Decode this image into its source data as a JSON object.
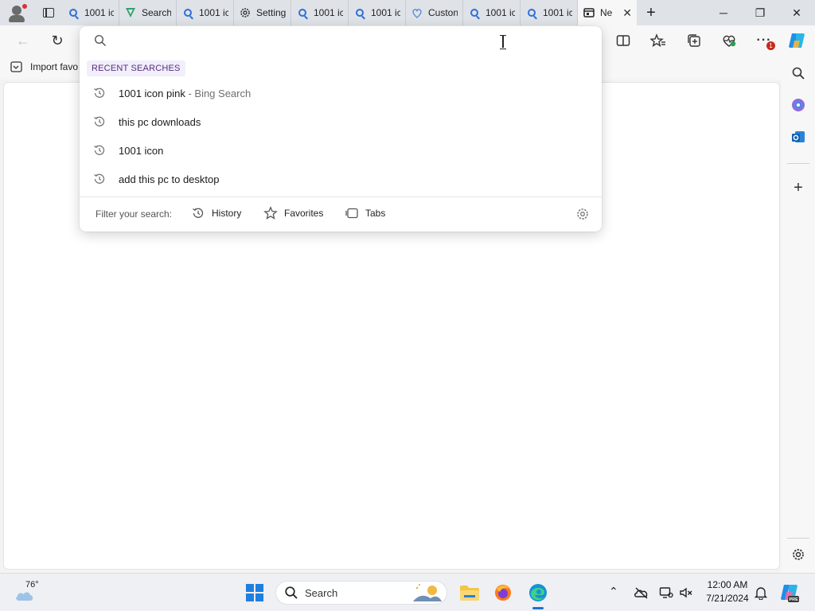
{
  "tabs": [
    {
      "icon": "search-icon",
      "title": "1001 ic"
    },
    {
      "icon": "search-tab-icon",
      "title": "Search"
    },
    {
      "icon": "search-icon",
      "title": "1001 ic"
    },
    {
      "icon": "settings-gear-icon",
      "title": "Setting"
    },
    {
      "icon": "search-icon",
      "title": "1001 ic"
    },
    {
      "icon": "search-icon",
      "title": "1001 ic"
    },
    {
      "icon": "shield-heart-icon",
      "title": "Custon"
    },
    {
      "icon": "search-icon",
      "title": "1001 ic"
    },
    {
      "icon": "search-icon",
      "title": "1001 ic"
    },
    {
      "icon": "new-tab-page-icon",
      "title": "Ne",
      "active": true
    }
  ],
  "favorites_bar": {
    "import_label": "Import favo"
  },
  "dropdown": {
    "search_placeholder": "",
    "heading": "RECENT SEARCHES",
    "items": [
      {
        "text": "1001 icon pink",
        "suffix": " - Bing Search"
      },
      {
        "text": "this pc downloads",
        "suffix": ""
      },
      {
        "text": "1001 icon",
        "suffix": ""
      },
      {
        "text": "add this pc to desktop",
        "suffix": ""
      }
    ],
    "filter_label": "Filter your search:",
    "filters": {
      "history": "History",
      "favorites": "Favorites",
      "tabs": "Tabs"
    }
  },
  "toolbar": {
    "notification_count": "1"
  },
  "taskbar": {
    "weather_temp": "76°",
    "search_label": "Search",
    "time": "12:00 AM",
    "date": "7/21/2024"
  },
  "colors": {
    "accent": "#1f6fd6",
    "heading_text": "#5a2c83",
    "heading_bg": "#f1effa"
  }
}
